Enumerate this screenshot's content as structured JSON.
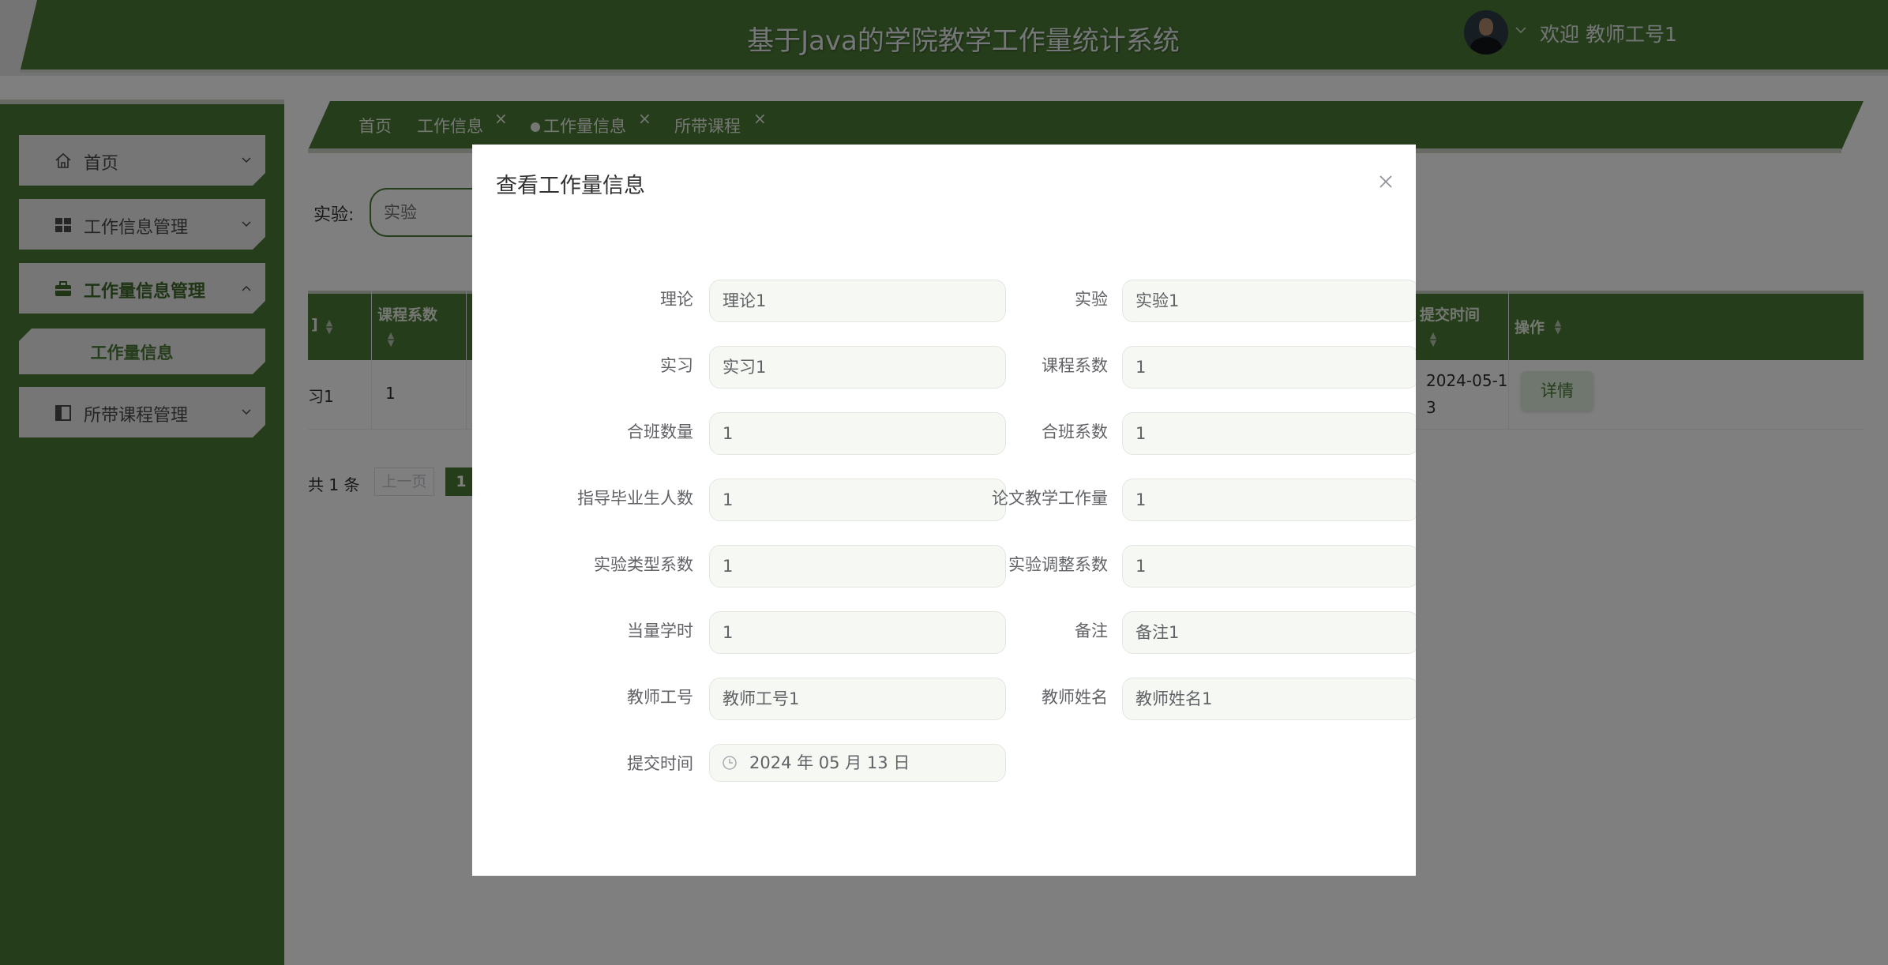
{
  "header": {
    "title": "基于Java的学院教学工作量统计系统",
    "welcome": "欢迎 教师工号1"
  },
  "sidebar": {
    "items": [
      {
        "label": "首页",
        "icon": "home-icon"
      },
      {
        "label": "工作信息管理",
        "icon": "grid-icon"
      },
      {
        "label": "工作量信息管理",
        "icon": "briefcase-icon"
      },
      {
        "label": "所带课程管理",
        "icon": "panel-icon"
      }
    ],
    "submenu": {
      "label": "工作量信息"
    }
  },
  "tabs": [
    {
      "label": "首页",
      "closable": false
    },
    {
      "label": "工作信息",
      "closable": true
    },
    {
      "label": "工作量信息",
      "closable": true,
      "active": true
    },
    {
      "label": "所带课程",
      "closable": true
    }
  ],
  "search": {
    "label": "实验:",
    "placeholder": "实验"
  },
  "table": {
    "headers": {
      "first_partial": "]",
      "course_coef": "课程系数",
      "submit_time": "提交时间",
      "actions": "操作"
    },
    "row": {
      "first_partial": "习1",
      "course_coef": "1",
      "submit_time_line1": "2024-05-1",
      "submit_time_line2": "3",
      "detail_label": "详情"
    }
  },
  "pager": {
    "total": "共 1 条",
    "prev": "上一页",
    "page": "1"
  },
  "dialog": {
    "title": "查看工作量信息",
    "fields_left": [
      {
        "label": "理论",
        "value": "理论1"
      },
      {
        "label": "实习",
        "value": "实习1"
      },
      {
        "label": "合班数量",
        "value": "1"
      },
      {
        "label": "指导毕业生人数",
        "value": "1"
      },
      {
        "label": "实验类型系数",
        "value": "1"
      },
      {
        "label": "当量学时",
        "value": "1"
      },
      {
        "label": "教师工号",
        "value": "教师工号1"
      },
      {
        "label": "提交时间",
        "value": "2024 年 05 月 13 日"
      }
    ],
    "fields_right": [
      {
        "label": "实验",
        "value": "实验1"
      },
      {
        "label": "课程系数",
        "value": "1"
      },
      {
        "label": "合班系数",
        "value": "1"
      },
      {
        "label": "论文教学工作量",
        "value": "1"
      },
      {
        "label": "实验调整系数",
        "value": "1"
      },
      {
        "label": "备注",
        "value": "备注1"
      },
      {
        "label": "教师姓名",
        "value": "教师姓名1"
      }
    ]
  },
  "colors": {
    "primary": "#4b7a35",
    "menu_bg": "#ececec",
    "overlay": "rgba(0,0,0,0.5)"
  }
}
